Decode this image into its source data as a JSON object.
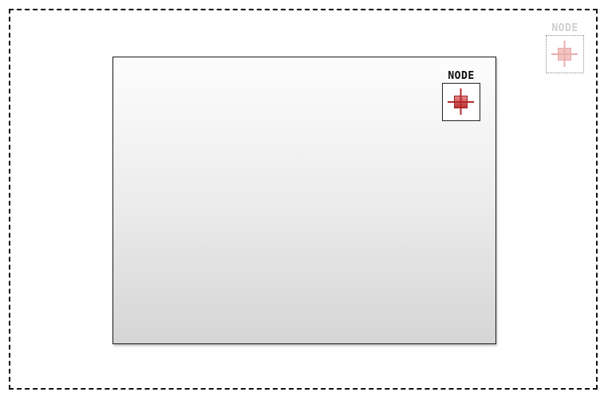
{
  "canvas": {
    "outer_frame_style": "dashed",
    "panel_gradient": [
      "#fdfdfd",
      "#d5d5d5"
    ]
  },
  "nodes": [
    {
      "label": "NODE",
      "state": "placed",
      "icon": "crosshair-node-icon",
      "label_color": "#0b0b0b",
      "accent": "#b42a2a"
    },
    {
      "label": "NODE",
      "state": "ghost",
      "icon": "crosshair-node-icon",
      "label_color": "#cfcfcf",
      "accent": "#e7a9a9"
    }
  ]
}
